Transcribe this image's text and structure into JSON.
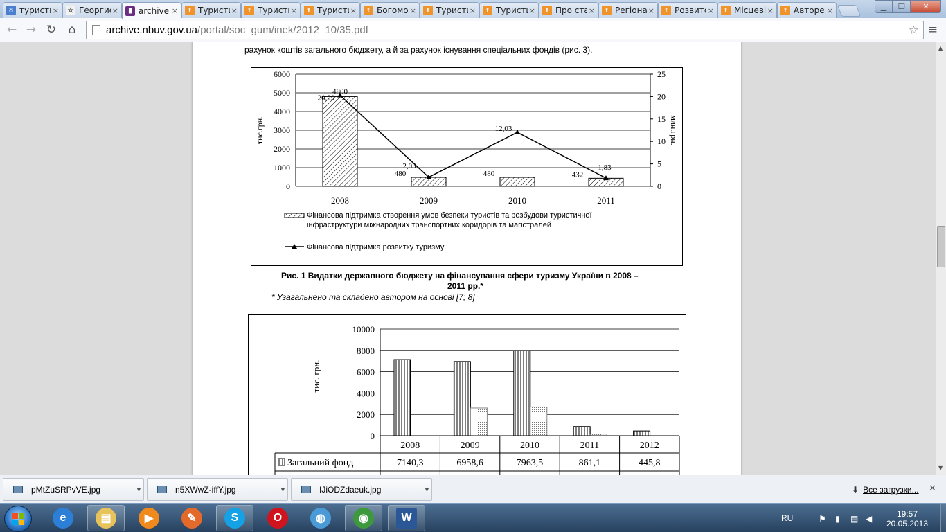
{
  "browser": {
    "tabs": [
      {
        "icon": "google-icon",
        "title": "туристические",
        "color": "#4a7fd0",
        "glyph": "8"
      },
      {
        "icon": "star-icon",
        "title": "Георгиевская",
        "color": "#f2f2f2",
        "glyph": "☆"
      },
      {
        "icon": "book-icon",
        "title": "archive.nbuv",
        "color": "#6b2d82",
        "glyph": "▮",
        "active": true
      },
      {
        "icon": "tourist-icon",
        "title": "Туристичні",
        "color": "#f0932b",
        "glyph": "t"
      },
      {
        "icon": "tourist-icon",
        "title": "Туристичні",
        "color": "#f0932b",
        "glyph": "t"
      },
      {
        "icon": "tourist-icon",
        "title": "Туристичні",
        "color": "#f0932b",
        "glyph": "t"
      },
      {
        "icon": "tourist-icon",
        "title": "Богомолець",
        "color": "#f0932b",
        "glyph": "t"
      },
      {
        "icon": "tourist-icon",
        "title": "Туристичні",
        "color": "#f0932b",
        "glyph": "t"
      },
      {
        "icon": "tourist-icon",
        "title": "Туристичні",
        "color": "#f0932b",
        "glyph": "t"
      },
      {
        "icon": "tourist-icon",
        "title": "Про стан",
        "color": "#f0932b",
        "glyph": "t"
      },
      {
        "icon": "tourist-icon",
        "title": "Регіональні",
        "color": "#f0932b",
        "glyph": "t"
      },
      {
        "icon": "tourist-icon",
        "title": "Розвиток",
        "color": "#f0932b",
        "glyph": "t"
      },
      {
        "icon": "tourist-icon",
        "title": "Місцеві",
        "color": "#f0932b",
        "glyph": "t"
      },
      {
        "icon": "tourist-icon",
        "title": "Автореферат",
        "color": "#f0932b",
        "glyph": "t"
      }
    ],
    "url_host": "archive.nbuv.gov.ua",
    "url_path": "/portal/soc_gum/inek/2012_10/35.pdf"
  },
  "pdf": {
    "intro_text": "рахунок коштів загального бюджету, а й за рахунок існування спеціальних фондів (рис. 3).",
    "fig1_caption_line1": "Рис. 1 Видатки державного бюджету на фінансування сфери туризму України в 2008 –",
    "fig1_caption_line2": "2011 рр.*",
    "fig1_note": "* Узагальнено та складено автором на основі [7; 8]"
  },
  "chart_data": [
    {
      "type": "bar",
      "categories": [
        "2008",
        "2009",
        "2010",
        "2011"
      ],
      "series": [
        {
          "name": "Фінансова підтримка створення умов безпеки туристів та розбудови туристичної інфраструктури міжнародних транспортних коридорів та магістралей",
          "values": [
            4800,
            480,
            480,
            432
          ],
          "labels": [
            "4800",
            "480",
            "480",
            "432"
          ],
          "axis": "left",
          "style": "hatched"
        },
        {
          "name": "Фінансова підтримка розвитку туризму",
          "values": [
            20.29,
            2.03,
            12.03,
            1.83
          ],
          "labels": [
            "20,29",
            "2,03",
            "12,03",
            "1,83"
          ],
          "axis": "right",
          "style": "line"
        }
      ],
      "ylabel": "тис.грн.",
      "y2label": "млн.грн.",
      "ylim": [
        0,
        6000
      ],
      "yticks": [
        "0",
        "1000",
        "2000",
        "3000",
        "4000",
        "5000",
        "6000"
      ],
      "y2lim": [
        0,
        25
      ],
      "y2ticks": [
        "0",
        "5",
        "10",
        "15",
        "20",
        "25"
      ],
      "legend_line1a": "Фінансова підтримка створення умов безпеки туристів та розбудови туристичної",
      "legend_line1b": "інфраструктури міжнародних транспортних коридорів та магістралей",
      "legend_line2": "Фінансова підтримка розвитку туризму",
      "grid": true,
      "legend_position": "bottom"
    },
    {
      "type": "bar",
      "categories": [
        "2008",
        "2009",
        "2010",
        "2011",
        "2012"
      ],
      "series": [
        {
          "name": "Загальний фонд",
          "values": [
            7140.3,
            6958.6,
            7963.5,
            861.1,
            445.8
          ],
          "labels": [
            "7140,3",
            "6958,6",
            "7963,5",
            "861,1",
            "445,8"
          ],
          "style": "vertical-stripes"
        },
        {
          "name": "",
          "values": [
            0,
            2600,
            2700,
            150,
            0
          ],
          "style": "dotted"
        }
      ],
      "ylabel": "тис. грн.",
      "ylim": [
        0,
        10000
      ],
      "yticks": [
        "0",
        "2000",
        "4000",
        "6000",
        "8000",
        "10000"
      ],
      "grid": true,
      "legend_position": "table-below"
    }
  ],
  "downloads": {
    "items": [
      "pMtZuSRPvVE.jpg",
      "n5XWwZ-iffY.jpg",
      "IJiODZdaeuk.jpg"
    ],
    "all_label": "Все загрузки..."
  },
  "taskbar": {
    "apps": [
      {
        "icon": "internet-explorer-icon",
        "color": "#2b7fd6",
        "glyph": "e"
      },
      {
        "icon": "file-explorer-icon",
        "color": "#e8c35a",
        "glyph": "▤",
        "open": true
      },
      {
        "icon": "media-player-icon",
        "color": "#f08a1c",
        "glyph": "▶"
      },
      {
        "icon": "paint-icon",
        "color": "#e46a2c",
        "glyph": "✎"
      },
      {
        "icon": "skype-icon",
        "color": "#14a1e6",
        "glyph": "S",
        "open": true
      },
      {
        "icon": "opera-icon",
        "color": "#d0141e",
        "glyph": "O"
      },
      {
        "icon": "network-globe-icon",
        "color": "#4a9ad8",
        "glyph": "◍"
      },
      {
        "icon": "chrome-icon",
        "color": "#3c9a3c",
        "glyph": "◉",
        "open": true
      },
      {
        "icon": "word-icon",
        "color": "#2b5797",
        "glyph": "W",
        "open": true
      }
    ],
    "lang": "RU",
    "time": "19:57",
    "date": "20.05.2013"
  }
}
